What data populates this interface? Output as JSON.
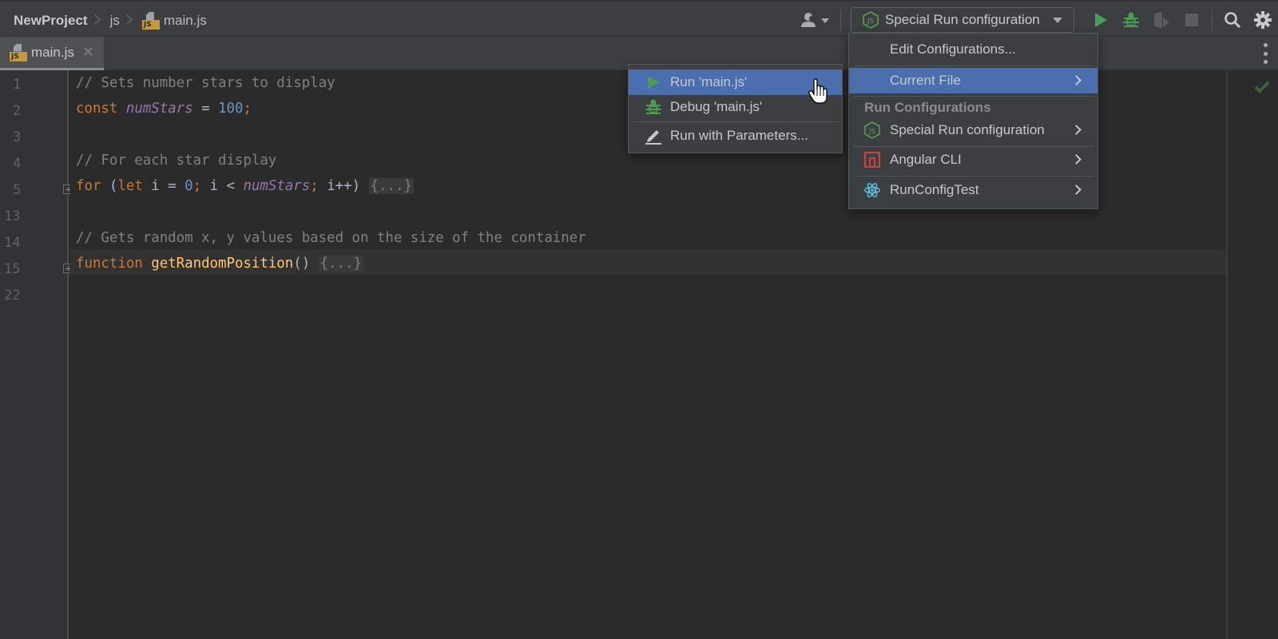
{
  "breadcrumb": {
    "project": "NewProject",
    "folder": "js",
    "file": "main.js",
    "file_icon": "js-file-icon"
  },
  "toolbar": {
    "vcs_icon": "user-vcs-icon",
    "run_config_label": "Special Run configuration",
    "run_config_icon": "nodejs-icon",
    "run_icon": "play-icon",
    "debug_icon": "bug-icon",
    "coverage_icon": "coverage-icon",
    "stop_icon": "stop-icon",
    "search_icon": "search-icon",
    "settings_icon": "gear-icon",
    "colors": {
      "run": "#499c54",
      "debug": "#499c54"
    }
  },
  "tabs": [
    {
      "label": "main.js",
      "icon": "js-file-icon",
      "active": true,
      "close_icon": "close-icon"
    }
  ],
  "editor": {
    "line_numbers": [
      "1",
      "2",
      "3",
      "4",
      "5",
      "13",
      "14",
      "15",
      "22"
    ],
    "lines": [
      {
        "tokens": [
          {
            "t": "// Sets number stars to display",
            "c": "c-comment"
          }
        ]
      },
      {
        "tokens": [
          {
            "t": "const",
            "c": "c-kw"
          },
          {
            "t": " "
          },
          {
            "t": "numStars",
            "c": "c-var"
          },
          {
            "t": " = "
          },
          {
            "t": "100",
            "c": "c-num"
          },
          {
            "t": ";",
            "c": "c-kw"
          }
        ]
      },
      {
        "tokens": []
      },
      {
        "tokens": [
          {
            "t": "// For each star display",
            "c": "c-comment"
          }
        ]
      },
      {
        "tokens": [
          {
            "t": "for",
            "c": "c-kw"
          },
          {
            "t": " ("
          },
          {
            "t": "let",
            "c": "c-kw"
          },
          {
            "t": " i = "
          },
          {
            "t": "0",
            "c": "c-num"
          },
          {
            "t": ";",
            "c": "c-kw"
          },
          {
            "t": " i < "
          },
          {
            "t": "numStars",
            "c": "c-var"
          },
          {
            "t": ";",
            "c": "c-kw"
          },
          {
            "t": " i++) "
          },
          {
            "t": "{...}",
            "c": "c-fold"
          }
        ],
        "foldable": true
      },
      {
        "tokens": []
      },
      {
        "tokens": [
          {
            "t": "// Gets random x, y values based on the size of the container",
            "c": "c-comment"
          }
        ]
      },
      {
        "tokens": [
          {
            "t": "function",
            "c": "c-kw"
          },
          {
            "t": " "
          },
          {
            "t": "getRandomPosition",
            "c": "c-fn"
          },
          {
            "t": "() "
          },
          {
            "t": "{...}",
            "c": "c-fold"
          }
        ],
        "foldable": true,
        "current": true
      },
      {
        "tokens": []
      }
    ],
    "inspection_status": "check-icon"
  },
  "run_menu": {
    "edit_configurations": "Edit Configurations...",
    "current_file": "Current File",
    "section_header": "Run Configurations",
    "configs": [
      {
        "label": "Special Run configuration",
        "icon": "nodejs-icon"
      },
      {
        "label": "Angular CLI",
        "icon": "angular-icon"
      },
      {
        "label": "RunConfigTest",
        "icon": "react-icon"
      }
    ]
  },
  "current_file_submenu": {
    "items": [
      {
        "label": "Run 'main.js'",
        "icon": "play-icon",
        "selected": true
      },
      {
        "label": "Debug 'main.js'",
        "icon": "bug-icon"
      },
      {
        "label": "Run with Parameters...",
        "icon": "pencil-icon"
      }
    ]
  }
}
